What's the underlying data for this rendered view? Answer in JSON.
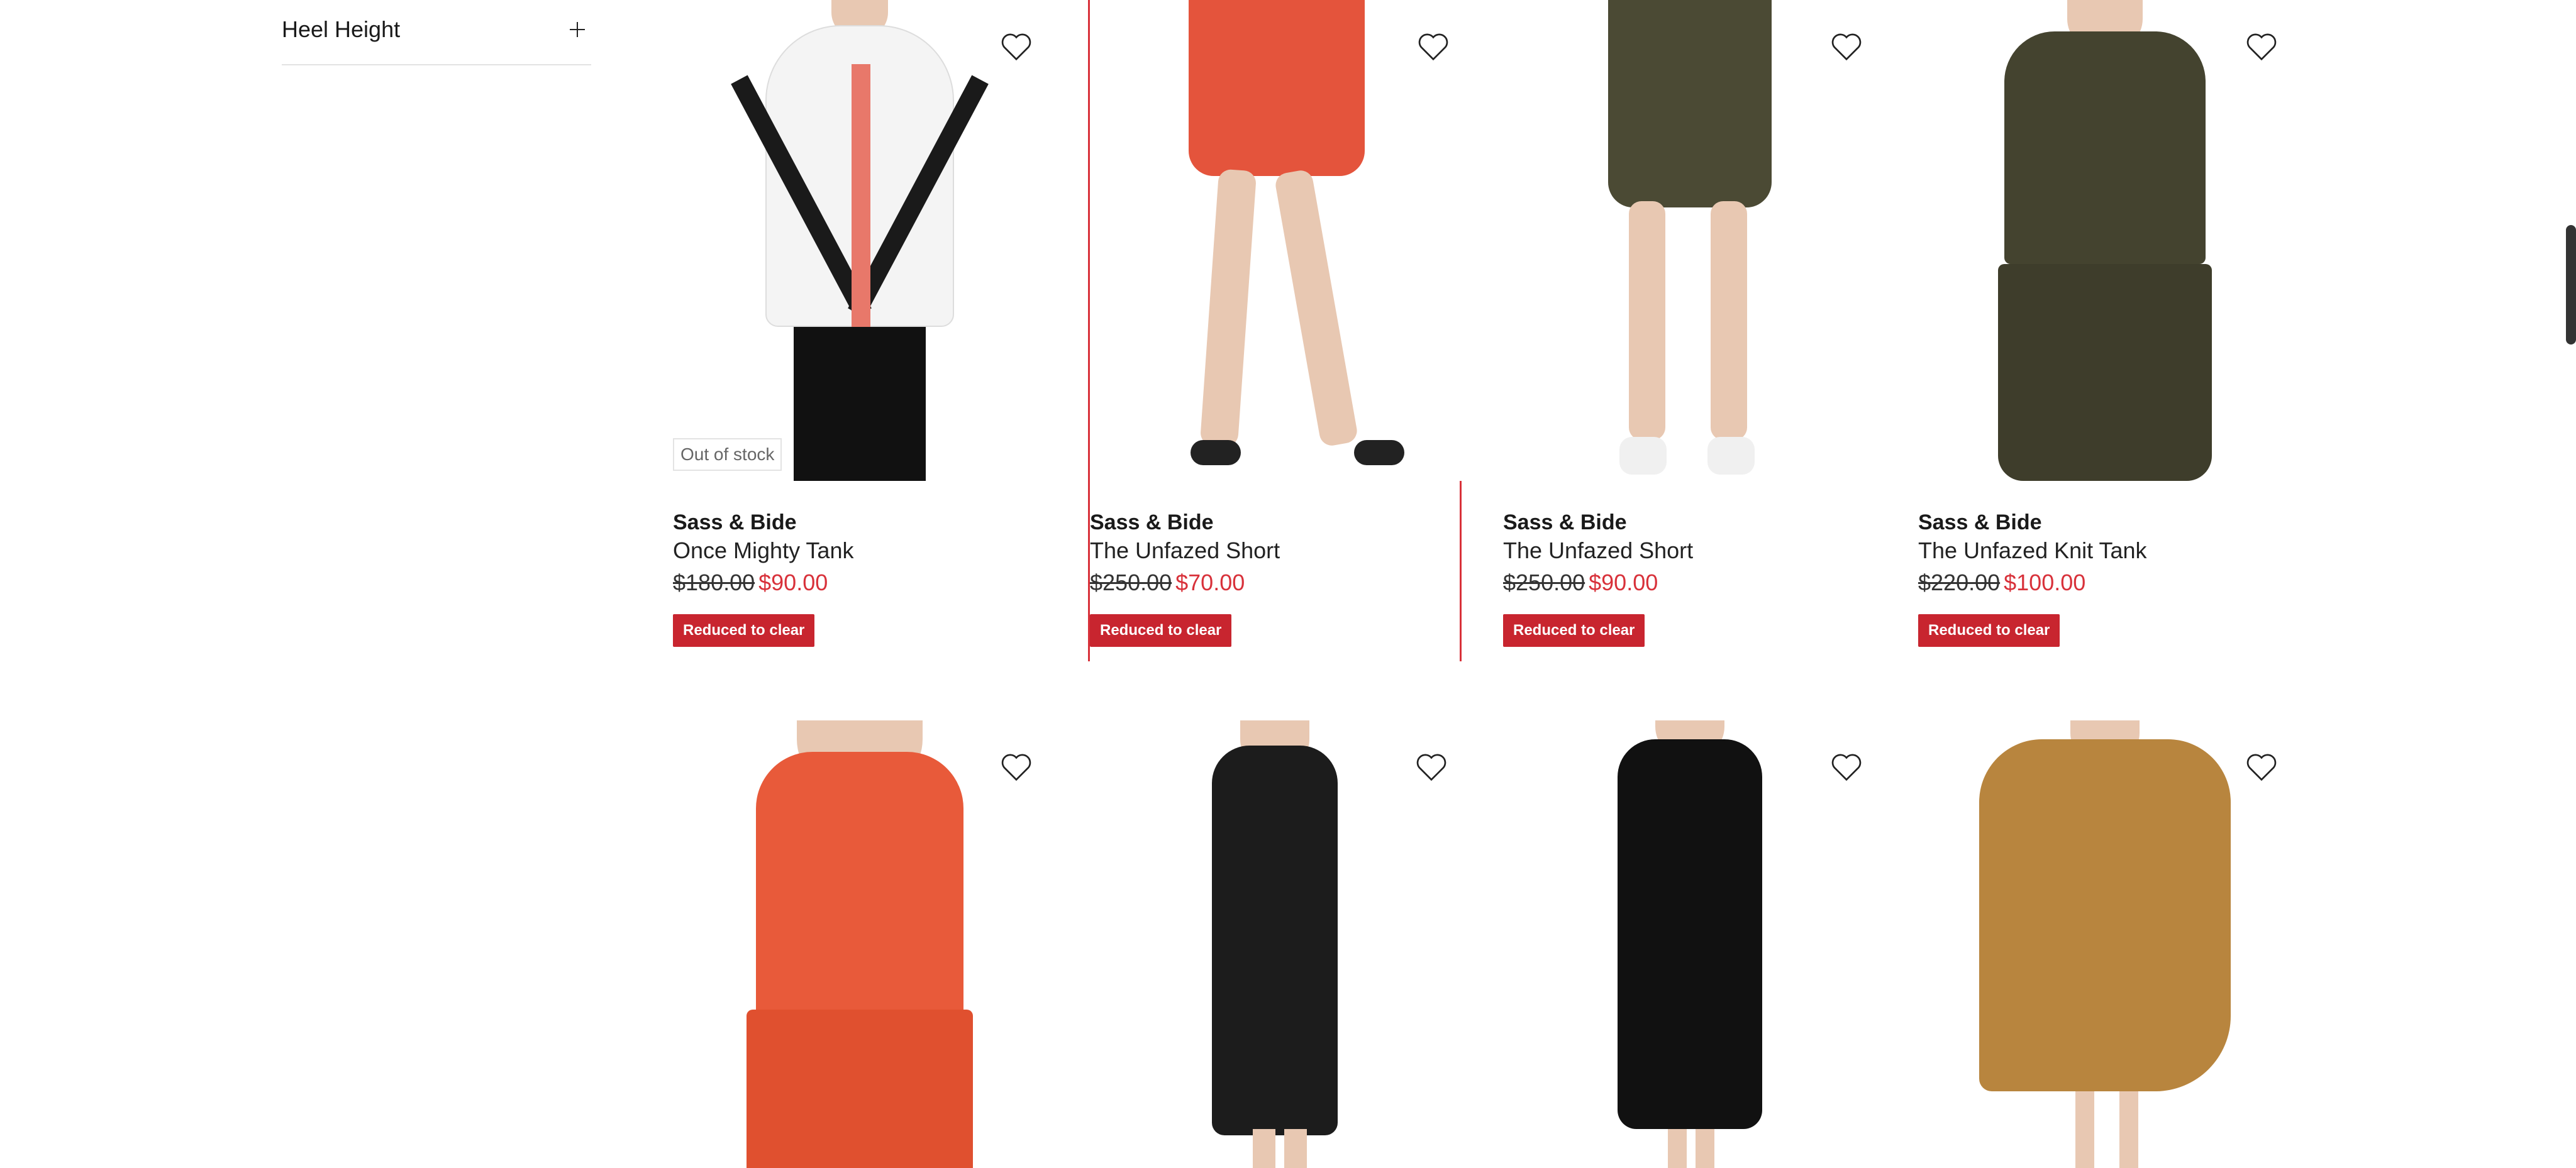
{
  "sidebar": {
    "filter": {
      "label": "Heel Height"
    }
  },
  "products": [
    {
      "brand": "Sass & Bide",
      "name": "Once Mighty Tank",
      "was_price": "$180.00",
      "now_price": "$90.00",
      "tag": "Reduced to clear",
      "badge": "Out of stock",
      "color": "#f2f2f2",
      "accent": "#e8786a"
    },
    {
      "brand": "Sass & Bide",
      "name": "The Unfazed Short",
      "was_price": "$250.00",
      "now_price": "$70.00",
      "tag": "Reduced to clear",
      "color": "#e4543c"
    },
    {
      "brand": "Sass & Bide",
      "name": "The Unfazed Short",
      "was_price": "$250.00",
      "now_price": "$90.00",
      "tag": "Reduced to clear",
      "color": "#4b4a34"
    },
    {
      "brand": "Sass & Bide",
      "name": "The Unfazed Knit Tank",
      "was_price": "$220.00",
      "now_price": "$100.00",
      "tag": "Reduced to clear",
      "color": "#44432f"
    },
    {
      "color": "#e85a3a"
    },
    {
      "color": "#1c1c1c"
    },
    {
      "color": "#111111"
    },
    {
      "color": "#b8853e"
    }
  ],
  "icons": {
    "wishlist": "heart-outline-icon",
    "expand": "plus-icon"
  }
}
